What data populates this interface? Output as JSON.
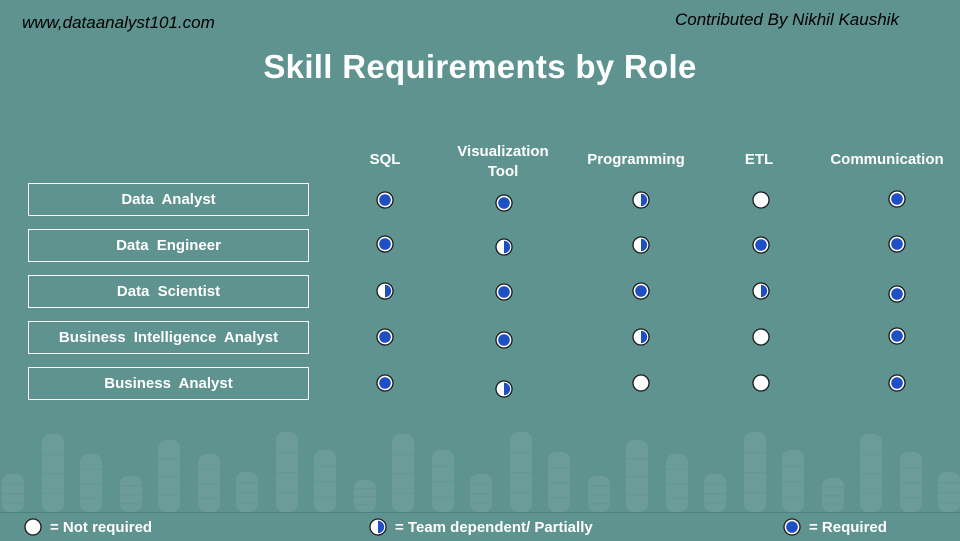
{
  "header": {
    "site_url": "www,dataanalyst101.com",
    "credit": "Contributed By Nikhil Kaushik",
    "title": "Skill Requirements by Role"
  },
  "colors": {
    "background": "#5e938f",
    "required_fill": "#1f4fc4",
    "not_required_fill": "#ffffff",
    "icon_stroke": "#1a1a1a"
  },
  "columns": [
    {
      "label": "SQL"
    },
    {
      "label": "Visualization\nTool"
    },
    {
      "label": "Programming"
    },
    {
      "label": "ETL"
    },
    {
      "label": "Communication"
    }
  ],
  "rows": [
    {
      "role": "Data Analyst",
      "skills": [
        "required",
        "required",
        "partial",
        "not_required",
        "required"
      ]
    },
    {
      "role": "Data Engineer",
      "skills": [
        "required",
        "partial",
        "partial",
        "required",
        "required"
      ]
    },
    {
      "role": "Data Scientist",
      "skills": [
        "partial",
        "required",
        "required",
        "partial",
        "required"
      ]
    },
    {
      "role": "Business  Intelligence  Analyst",
      "skills": [
        "required",
        "required",
        "partial",
        "not_required",
        "required"
      ]
    },
    {
      "role": "Business  Analyst",
      "skills": [
        "required",
        "partial",
        "not_required",
        "not_required",
        "required"
      ]
    }
  ],
  "legend": [
    {
      "status": "not_required",
      "label": "= Not required"
    },
    {
      "status": "partial",
      "label": "= Team dependent/  Partially"
    },
    {
      "status": "required",
      "label": "= Required"
    }
  ]
}
